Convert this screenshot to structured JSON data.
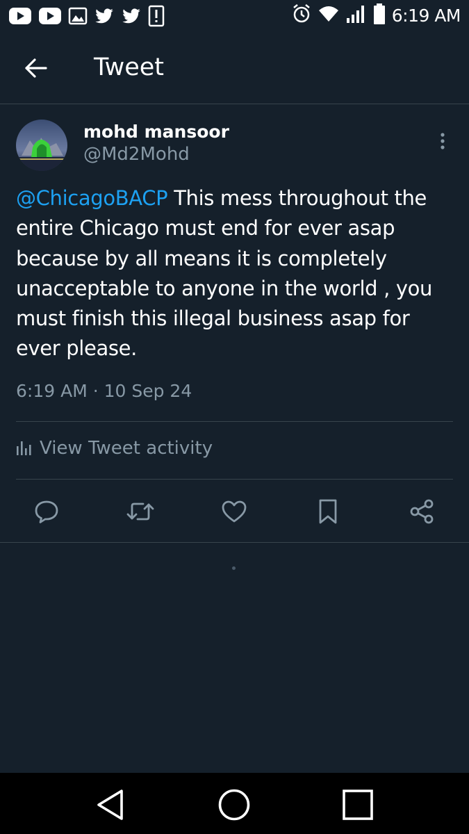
{
  "status_bar": {
    "time": "6:19 AM",
    "left_icons": [
      "youtube-icon",
      "youtube-icon",
      "gallery-icon",
      "twitter-icon",
      "twitter-icon",
      "alert-icon"
    ],
    "right_icons": [
      "alarm-icon",
      "wifi-icon",
      "signal-icon",
      "battery-icon"
    ]
  },
  "app_bar": {
    "title": "Tweet"
  },
  "tweet": {
    "display_name": "mohd mansoor",
    "handle": "@Md2Mohd",
    "mention": "@ChicagoBACP",
    "body": " This mess throughout the entire Chicago must end for ever asap because by all means it is completely unacceptable to anyone in the world , you must finish this illegal business asap for ever please.",
    "timestamp": "6:19 AM · 10 Sep 24",
    "activity_label": "View Tweet activity"
  },
  "actions": [
    "reply-icon",
    "retweet-icon",
    "like-icon",
    "bookmark-icon",
    "share-icon"
  ],
  "colors": {
    "background": "#15202b",
    "divider": "#38444d",
    "secondary_text": "#8899a6",
    "link": "#1da1f2",
    "nav_bar": "#000000"
  }
}
